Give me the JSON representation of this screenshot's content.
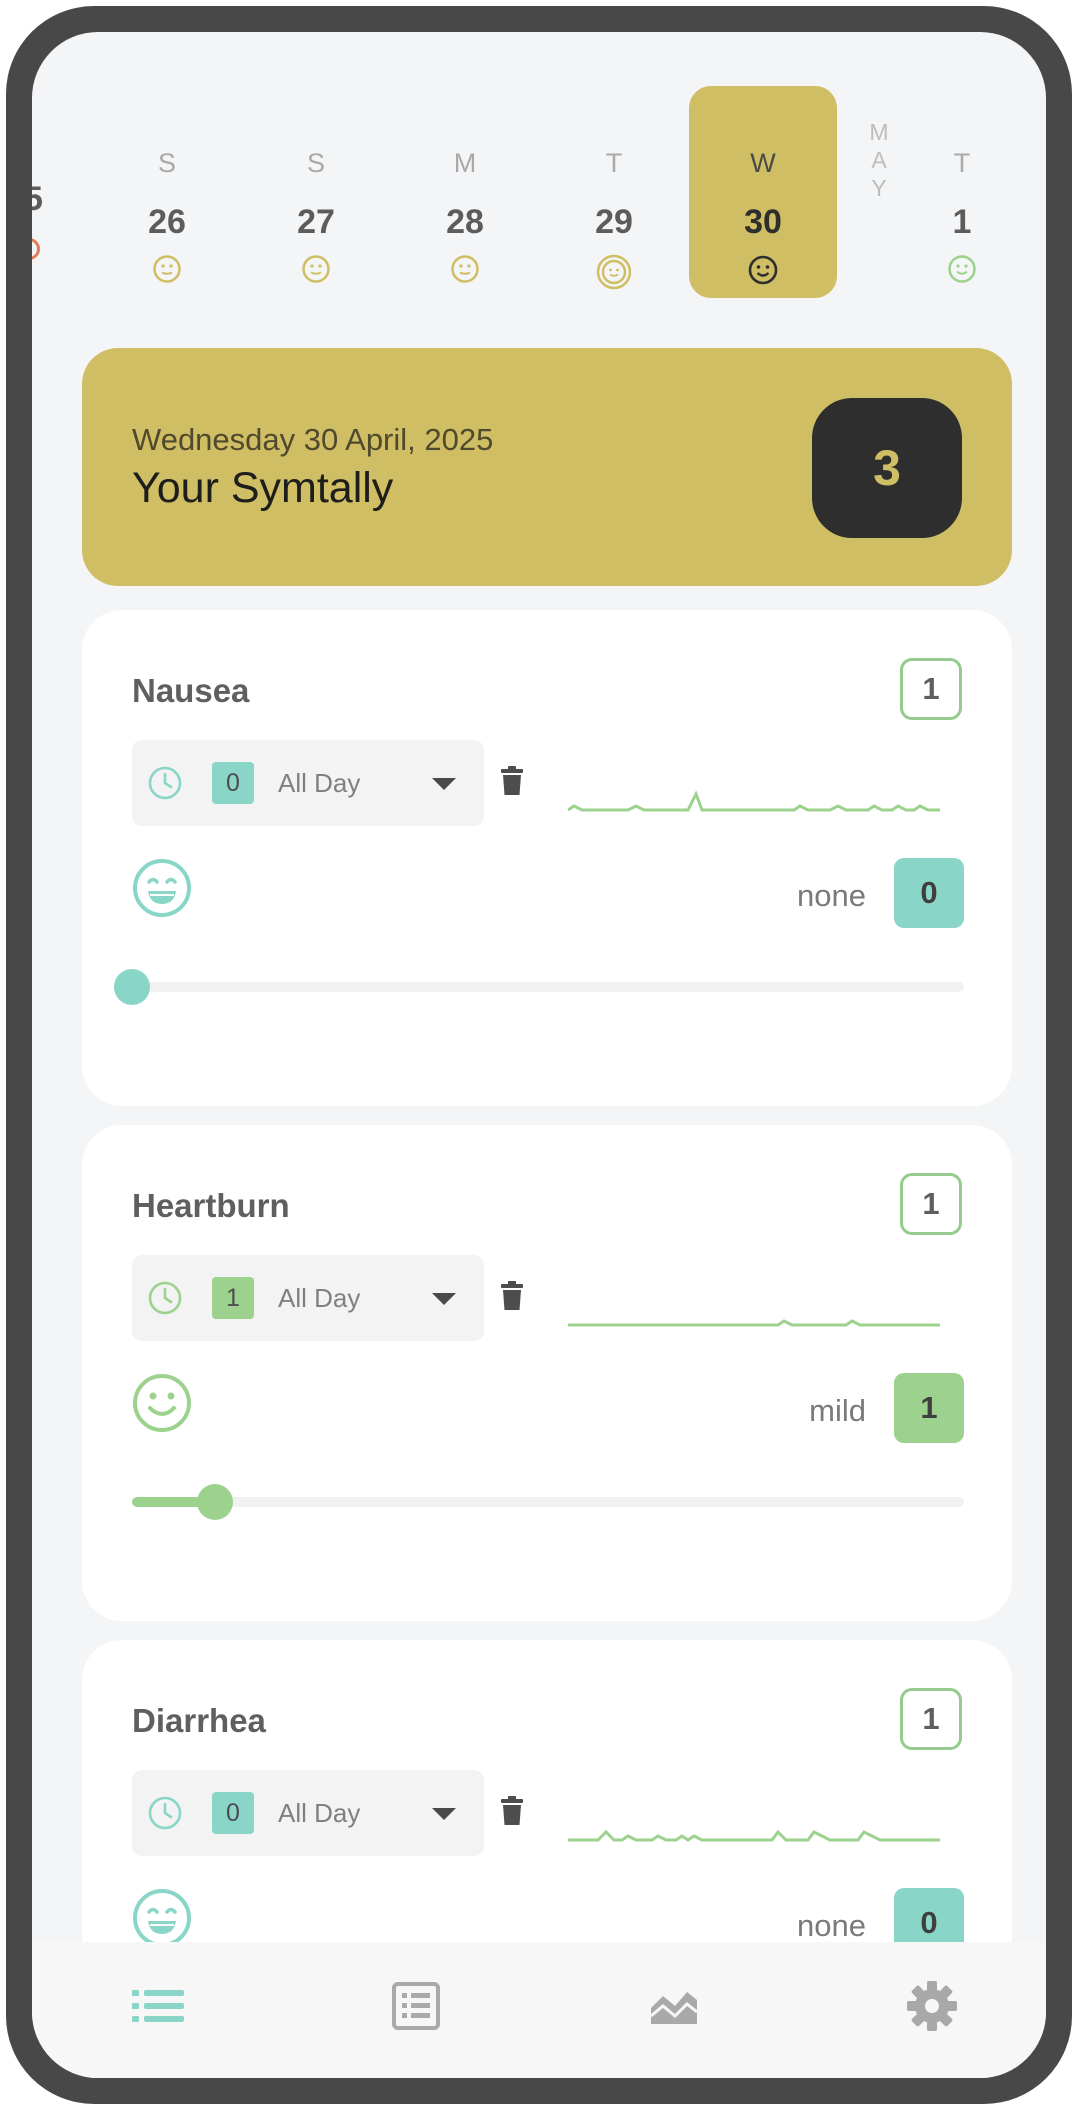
{
  "date_strip": {
    "partial_left_day": "5",
    "days": [
      {
        "dow": "S",
        "num": "26"
      },
      {
        "dow": "S",
        "num": "27"
      },
      {
        "dow": "M",
        "num": "28"
      },
      {
        "dow": "T",
        "num": "29"
      },
      {
        "dow": "W",
        "num": "30",
        "selected": true
      },
      {
        "dow": "T",
        "num": "1"
      }
    ],
    "month_letters": [
      "M",
      "A",
      "Y"
    ]
  },
  "header": {
    "date": "Wednesday 30 April, 2025",
    "title": "Your Symtally",
    "count": "3"
  },
  "symptoms": [
    {
      "name": "Nausea",
      "count": "1",
      "time_value": "0",
      "time_label": "All Day",
      "severity_label": "none",
      "severity_value": "0",
      "severity_fraction": 0,
      "color": "#89d6c8",
      "face": "grin"
    },
    {
      "name": "Heartburn",
      "count": "1",
      "time_value": "1",
      "time_label": "All Day",
      "severity_label": "mild",
      "severity_value": "1",
      "severity_fraction": 0.1,
      "color": "#9dd28e",
      "face": "smile"
    },
    {
      "name": "Diarrhea",
      "count": "1",
      "time_value": "0",
      "time_label": "All Day",
      "severity_label": "none",
      "severity_value": "0",
      "severity_fraction": 0,
      "color": "#89d6c8",
      "face": "grin"
    }
  ],
  "colors": {
    "accent": "#cfbe63",
    "teal": "#89d6c8",
    "green": "#9dd28e",
    "dark": "#2e2e2e"
  },
  "nav": [
    {
      "icon": "list-icon",
      "active": true
    },
    {
      "icon": "log-icon",
      "active": false
    },
    {
      "icon": "chart-icon",
      "active": false
    },
    {
      "icon": "settings-icon",
      "active": false
    }
  ]
}
